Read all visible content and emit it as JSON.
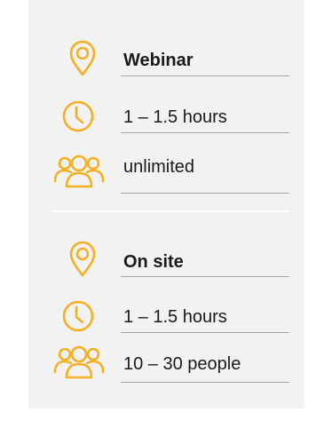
{
  "accent_color": "#f5b021",
  "sections": [
    {
      "location": {
        "icon": "location-pin-icon",
        "label": "Webinar"
      },
      "duration": {
        "icon": "clock-icon",
        "label": "1 – 1.5 hours"
      },
      "participants": {
        "icon": "people-group-icon",
        "label": "unlimited"
      }
    },
    {
      "location": {
        "icon": "location-pin-icon",
        "label": "On site"
      },
      "duration": {
        "icon": "clock-icon",
        "label": "1 – 1.5 hours"
      },
      "participants": {
        "icon": "people-group-icon",
        "label": "10 – 30 people"
      }
    }
  ]
}
